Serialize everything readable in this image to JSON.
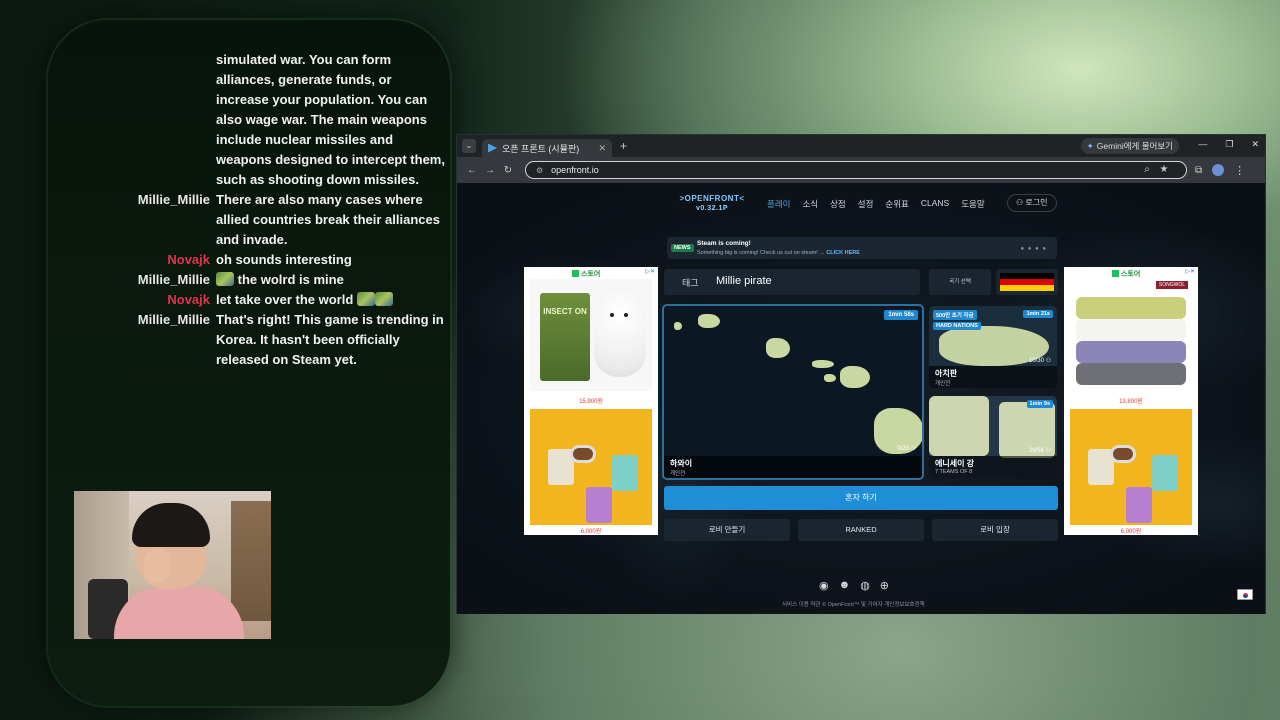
{
  "chat": {
    "messages": [
      {
        "user": "",
        "text": "simulated war. You can form alliances, generate funds, or increase your population. You can also wage war. The main weapons include nuclear missiles and weapons designed to intercept them, such as shooting down missiles."
      },
      {
        "user": "Millie_Millie",
        "text": "There are also many cases where allied countries break their alliances and invade."
      },
      {
        "user": "Novajk",
        "text": "oh sounds interesting"
      },
      {
        "user": "Millie_Millie",
        "text": " the wolrd is mine"
      },
      {
        "user": "Novajk",
        "text": "let take over the world "
      },
      {
        "user": "Millie_Millie",
        "text": "That's right! This game is trending in Korea. It hasn't been officially released on Steam yet."
      }
    ],
    "user_colors": {
      "Millie_Millie": "#e8e8e8",
      "Novajk": "#e0324d"
    }
  },
  "browser": {
    "tab_title": "오픈 프론트 (시뮬판)",
    "gemini_label": "Gemini에게 물어보기",
    "url": "openfront.io"
  },
  "site": {
    "logo": ">OPENFRONT<",
    "version": "v0.32.1P",
    "menu": [
      "플레이",
      "소식",
      "상점",
      "설정",
      "순위표",
      "CLANS",
      "도움말"
    ],
    "login": "로그인",
    "news": {
      "badge": "NEWS",
      "title": "Steam is coming!",
      "subtitle": "Something big is coming! Check us out on steam! ",
      "link": "→ CLICK HERE"
    },
    "name_tag": "태그",
    "name_value": "Millie pirate",
    "flag_label": "국기 선택",
    "flag_colors": [
      "#000000",
      "#dd0000",
      "#ffce00"
    ],
    "maps": {
      "main": {
        "name": "하와이",
        "sub": "개인전",
        "timer": "1min 58s",
        "players": "0/20"
      },
      "top_right": {
        "name": "아치판",
        "sub": "개인전",
        "timer": "1min 21s",
        "badge1": "500만 초기 자금",
        "badge2": "HARD NATIONS",
        "players": "10/30"
      },
      "bottom_right": {
        "name": "에니세이 강",
        "sub": "7 TEAMS OF 8",
        "timer": "1min 9s",
        "players": "29/56"
      }
    },
    "play_solo": "혼자 하기",
    "buttons": [
      "로비 만들기",
      "RANKED",
      "로비 입장"
    ],
    "footer": "서비스 이용 약관   © OpenFront™ 및 기여자   개인정보보호정책"
  },
  "ads": {
    "store_label": "스토어",
    "left_prices": [
      "15,900원",
      "6,000원"
    ],
    "right_prices": [
      "13,800원",
      "6,000원"
    ],
    "bag_text": "INSECT ON",
    "brand": "SONGWOL"
  }
}
